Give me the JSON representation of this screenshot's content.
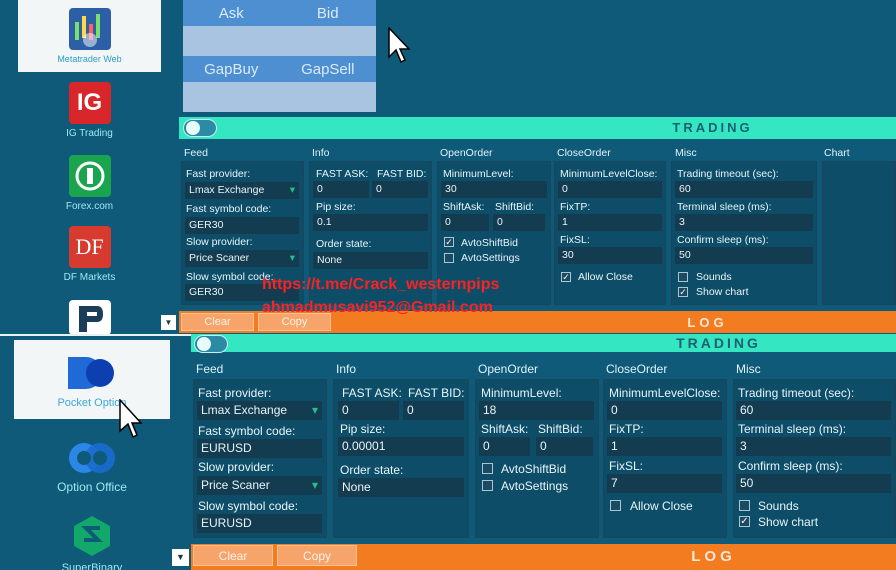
{
  "sidebar_top": [
    {
      "label": "Metatrader Web",
      "icon": "metatrader-icon"
    },
    {
      "label": "IG Trading",
      "icon": "ig-icon"
    },
    {
      "label": "Forex.com",
      "icon": "forex-icon"
    },
    {
      "label": "DF Markets",
      "icon": "df-icon"
    }
  ],
  "sidebar_bottom": [
    {
      "label": "Pocket Option",
      "icon": "pocket-option-icon"
    },
    {
      "label": "Option Office",
      "icon": "option-office-icon"
    },
    {
      "label": "SuperBinary",
      "icon": "superbinary-icon"
    }
  ],
  "quote": {
    "ask": "Ask",
    "bid": "Bid",
    "gapbuy": "GapBuy",
    "gapsell": "GapSell"
  },
  "trading_label": "TRADING",
  "log_label": "LOG",
  "buttons": {
    "clear": "Clear",
    "copy": "Copy"
  },
  "sections": {
    "feed": "Feed",
    "info": "Info",
    "openorder": "OpenOrder",
    "closeorder": "CloseOrder",
    "misc": "Misc",
    "chart": "Chart"
  },
  "labels": {
    "fast_provider": "Fast provider:",
    "fast_symbol": "Fast symbol code:",
    "slow_provider": "Slow provider:",
    "slow_symbol": "Slow symbol code:",
    "fast_ask": "FAST ASK:",
    "fast_bid": "FAST BID:",
    "pip_size": "Pip size:",
    "order_state": "Order state:",
    "min_level": "MinimumLevel:",
    "shift_ask": "ShiftAsk:",
    "shift_bid": "ShiftBid:",
    "avto_shift_bid": "AvtoShiftBid",
    "avto_settings": "AvtoSettings",
    "min_level_close": "MinimumLevelClose:",
    "fix_tp": "FixTP:",
    "fix_sl": "FixSL:",
    "allow_close": "Allow Close",
    "trading_timeout": "Trading timeout (sec):",
    "terminal_sleep": "Terminal sleep (ms):",
    "confirm_sleep": "Confirm sleep (ms):",
    "sounds": "Sounds",
    "show_chart": "Show chart"
  },
  "top_values": {
    "fast_provider": "Lmax Exchange",
    "fast_symbol": "GER30",
    "slow_provider": "Price Scaner",
    "slow_symbol": "GER30",
    "fast_ask": "0",
    "fast_bid": "0",
    "pip_size": "0.1",
    "order_state": "None",
    "min_level": "30",
    "shift_ask": "0",
    "shift_bid": "0",
    "avto_shift_bid": true,
    "avto_settings": false,
    "min_level_close": "0",
    "fix_tp": "1",
    "fix_sl": "30",
    "allow_close": true,
    "trading_timeout": "60",
    "terminal_sleep": "3",
    "confirm_sleep": "50",
    "sounds": false,
    "show_chart": true
  },
  "bottom_values": {
    "fast_provider": "Lmax Exchange",
    "fast_symbol": "EURUSD",
    "slow_provider": "Price Scaner",
    "slow_symbol": "EURUSD",
    "fast_ask": "0",
    "fast_bid": "0",
    "pip_size": "0.00001",
    "order_state": "None",
    "min_level": "18",
    "shift_ask": "0",
    "shift_bid": "0",
    "avto_shift_bid": false,
    "avto_settings": false,
    "min_level_close": "0",
    "fix_tp": "1",
    "fix_sl": "7",
    "allow_close": false,
    "trading_timeout": "60",
    "terminal_sleep": "3",
    "confirm_sleep": "50",
    "sounds": false,
    "show_chart": true
  },
  "watermark": {
    "line1": "https://t.me/Crack_westernpips",
    "line2": "ahmadmusavi952@Gmail.com"
  },
  "colors": {
    "background": "#0e5a78",
    "trading_bar": "#35e6c3",
    "log_bar": "#f47c20",
    "quote_panel": "#4d8fd1",
    "watermark": "#ff2020"
  }
}
